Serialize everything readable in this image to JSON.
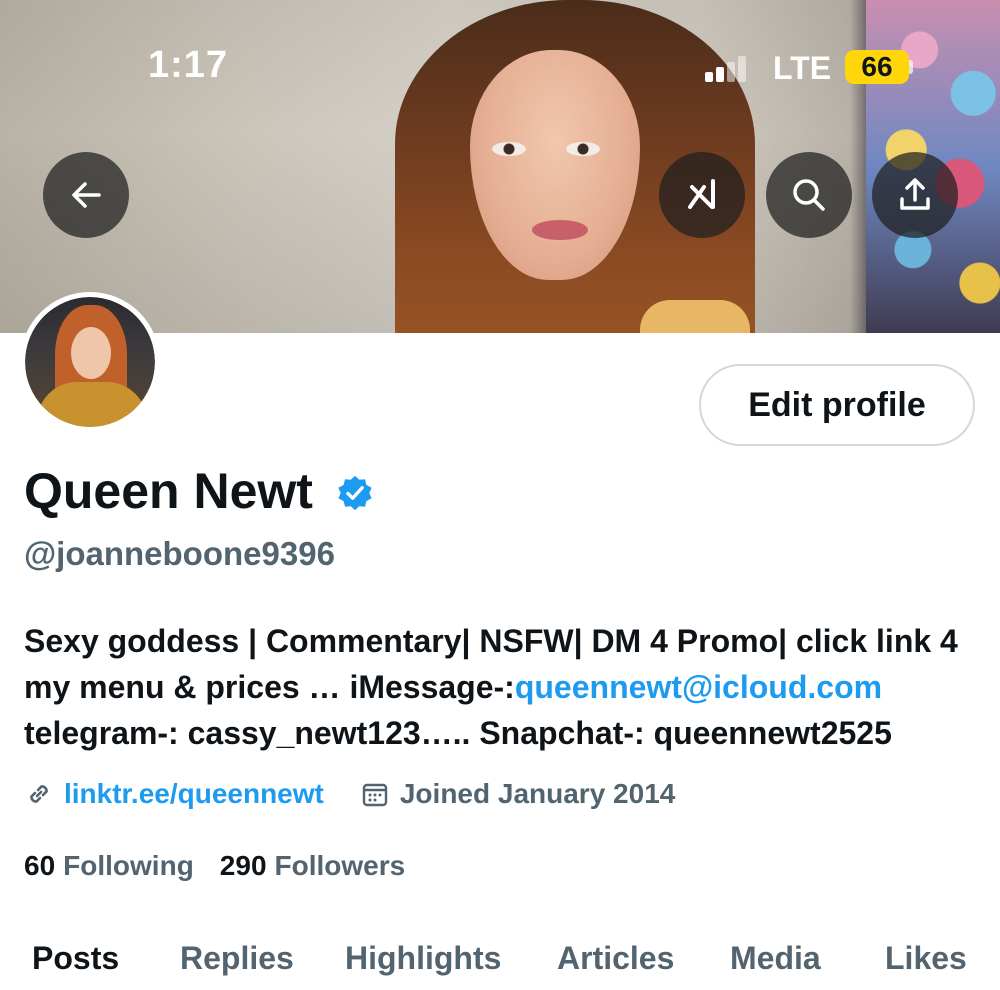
{
  "status_bar": {
    "time": "1:17",
    "network": "LTE",
    "battery": "66"
  },
  "banner": {
    "icons": [
      "arrow-left-icon",
      "grok-icon",
      "search-icon",
      "share-icon"
    ]
  },
  "profile": {
    "edit_button": "Edit profile",
    "display_name": "Queen Newt",
    "handle": "@joanneboone9396",
    "bio": {
      "line1": "Sexy goddess | Commentary| NSFW| DM 4 Promo| click link 4",
      "line2_prefix": "my menu & prices … iMessage-:",
      "line2_link": "queennewt@icloud.com",
      "line3": "telegram-: cassy_newt123….. Snapchat-: queennewt2525"
    },
    "website": "linktr.ee/queennewt",
    "joined": "Joined January 2014",
    "following_count": "60",
    "following_label": "Following",
    "followers_count": "290",
    "followers_label": "Followers"
  },
  "tabs": [
    "Posts",
    "Replies",
    "Highlights",
    "Articles",
    "Media",
    "Likes"
  ],
  "colors": {
    "accent": "#1d9bf0",
    "secondary_text": "#536471",
    "primary_text": "#0f1419",
    "battery": "#ffd60a"
  }
}
